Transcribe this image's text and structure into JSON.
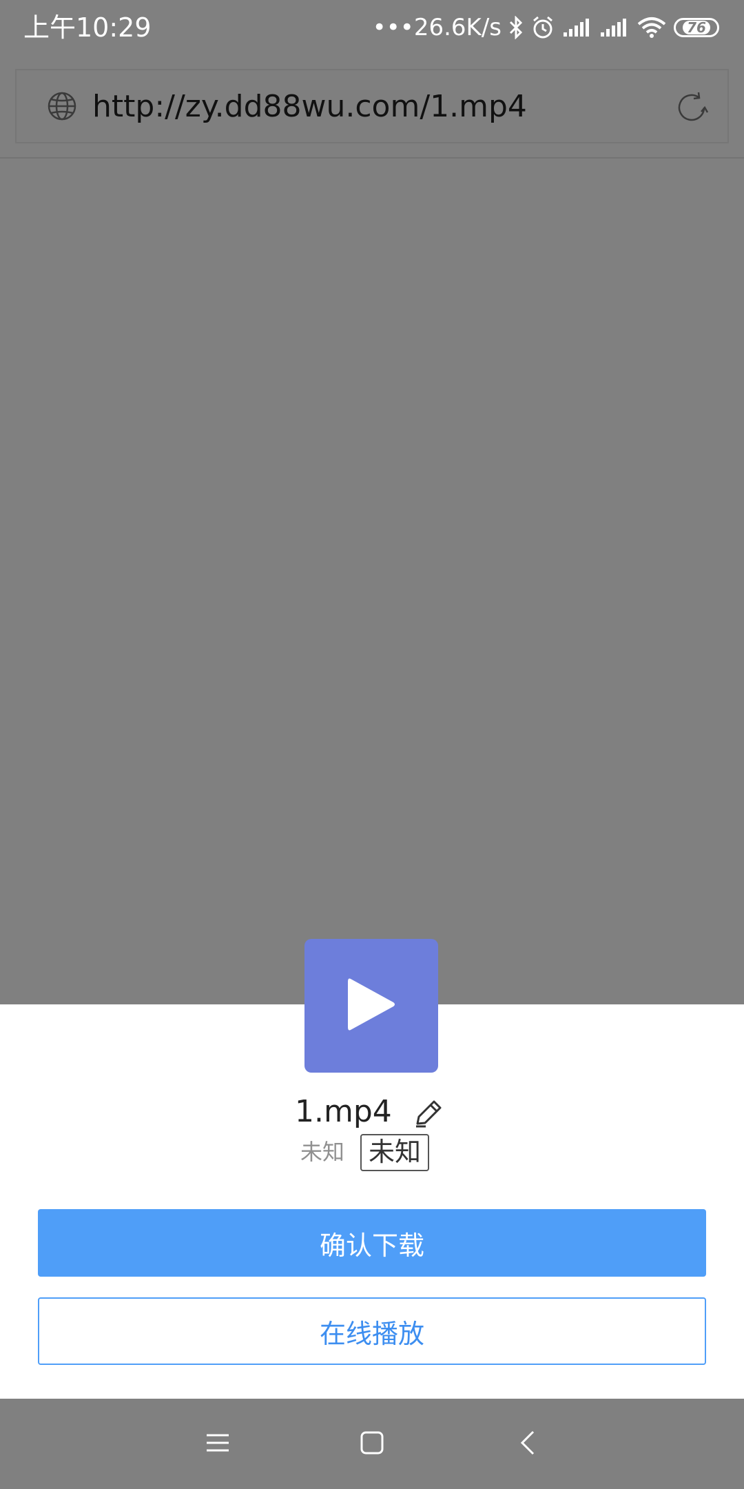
{
  "status_bar": {
    "time": "上午10:29",
    "network_speed": "•••26.6K/s",
    "battery_level": "76",
    "icons": [
      "bluetooth-icon",
      "alarm-icon",
      "signal-icon",
      "signal-icon",
      "wifi-icon",
      "battery-icon"
    ]
  },
  "address_bar": {
    "url": "http://zy.dd88wu.com/1.mp4",
    "left_icon": "globe-icon",
    "right_icon": "refresh-icon"
  },
  "download_sheet": {
    "thumbnail_icon": "play-icon",
    "thumbnail_color": "#6d7edb",
    "file_name": "1.mp4",
    "edit_icon": "pencil-icon",
    "size_label": "未知",
    "type_badge": "未知",
    "confirm_label": "确认下载",
    "play_online_label": "在线播放",
    "accent_color": "#4f9ef8"
  },
  "nav_bar": {
    "icons": [
      "menu-icon",
      "home-icon",
      "back-icon"
    ]
  }
}
